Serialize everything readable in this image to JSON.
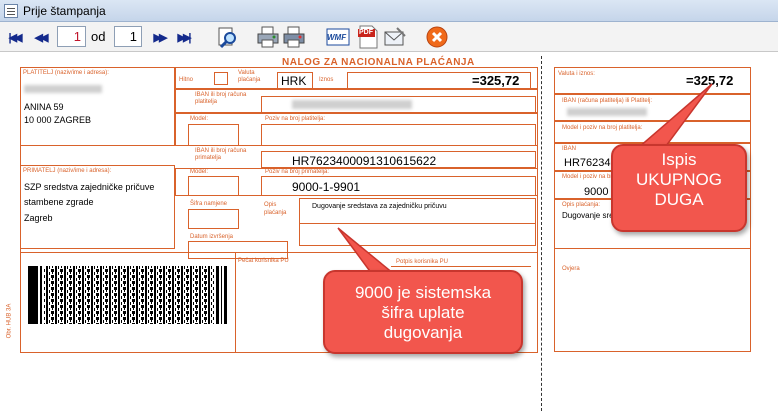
{
  "window": {
    "title": "Prije štampanja",
    "icon": "document-window-icon"
  },
  "toolbar": {
    "current_page": "1",
    "of_label": "od",
    "total_pages": "1",
    "buttons": {
      "first": "first-page-icon",
      "prev": "previous-page-icon",
      "next": "next-page-icon",
      "last": "last-page-icon",
      "zoom": "zoom-icon",
      "print_setup": "print-setup-icon",
      "print": "print-icon",
      "wmf": "WMF",
      "pdf": "PDF",
      "email": "email-icon",
      "close": "close-icon"
    }
  },
  "form": {
    "title": "NALOG ZA NACIONALNA PLAĆANJA",
    "payer_label": "PLATITELJ (naziv/ime i adresa):",
    "payer_address1": "ANINA 59",
    "payer_address2": "10 000 ZAGREB",
    "hitno_label": "Hitno",
    "currency_label": "Valuta plaćanja",
    "currency": "HRK",
    "amount_label": "Iznos",
    "amount": "=325,72",
    "iban_payer_label": "IBAN ili broj računa platitelja",
    "model_label": "Model:",
    "ref_payer_label": "Poziv na broj platitelja:",
    "iban_recipient_label": "IBAN ili broj računa primatelja",
    "iban_recipient": "HR7623400091310615622",
    "recipient_label": "PRIMATELJ (naziv/ime i adresa):",
    "recipient_line1": "SZP sredstva zajedničke pričuve",
    "recipient_line2": "stambene zgrade",
    "recipient_line3": "Zagreb",
    "model2_label": "Model:",
    "ref_recipient_label": "Poziv na broj primatelja:",
    "ref_recipient": "9000-1-9901",
    "namjena_label": "Šifra namjene",
    "opis_label": "Opis plaćanja",
    "opis": "Dugovanje sredstava za zajedničku pričuvu",
    "datum_label": "Datum izvršenja",
    "pecat_label": "Pečat korisnika PU",
    "potpis_label": "Potpis korisnika PU",
    "side_code": "Obr. HUB 3A",
    "stub_amount_label": "Valuta i iznos:",
    "stub_amount": "=325,72",
    "stub_iban_payer_label": "IBAN (računa platitelja) ili Platitelj:",
    "stub_model_label": "Model i poziv na broj platitelja:",
    "stub_iban_recipient_label": "IBAN",
    "stub_iban_recipient": "HR762340",
    "stub_model2_label": "Model i poziv na broj primatelja:",
    "stub_ref": "9000",
    "stub_opis_label": "Opis plaćanja:",
    "stub_opis": "Dugovanje sre",
    "stub_ovjera": "Ovjera"
  },
  "callouts": {
    "total": [
      "Ispis",
      "UKUPNOG",
      "DUGA"
    ],
    "system_code": [
      "9000 je sistemska",
      "šifra uplate",
      "dugovanja"
    ]
  },
  "colors": {
    "form_accent": "#d9622b",
    "callout_fill": "#f2564d",
    "toolbar_blue": "#1b2c86"
  }
}
